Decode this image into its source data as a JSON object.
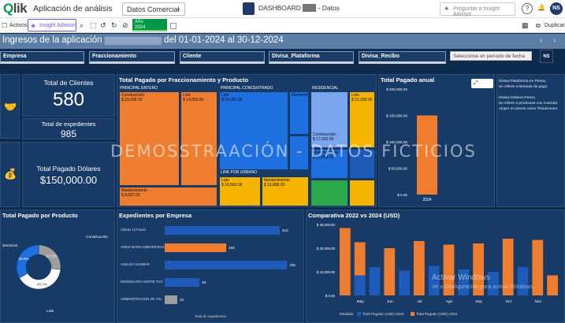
{
  "topbar": {
    "logo": "lik",
    "app_name": "Aplicación de análisis",
    "sheet_selector": "Datos Comercial",
    "dashboard_title": "DASHBOARD ",
    "dashboard_title_suffix": "- Datos",
    "search_placeholder": "Preguntar a Insight Advisor",
    "avatar": "NS"
  },
  "toolbar2": {
    "activos": "Activos",
    "insight": "Insight Advisor",
    "selection_field": "Año",
    "selection_value": "2024",
    "duplicar": "Duplicar"
  },
  "header": {
    "title_prefix": "Ingresos de la aplicación",
    "title_suffix": "del 01-01-2024 al 30-12-2024"
  },
  "filters": {
    "items": [
      "Empresa",
      "Fraccionamiento",
      "Cliente",
      "Divisa_Plataforma",
      "Divisa_Recibo"
    ],
    "date_placeholder": "Selecciona un periodo de fecha",
    "badge": "NS"
  },
  "kpis": {
    "clientes_label": "Total de Clientes",
    "clientes_value": "580",
    "expedientes_label": "Total de expedientes",
    "expedientes_value": "985",
    "pagado_label": "Total Pagado Dólares",
    "pagado_value": "$150,000.00"
  },
  "treemap": {
    "title": "Total Pagado por Fraccionamiento y Producto",
    "cells": [
      {
        "label": "PRINCIPAL ENTERO",
        "sub": "Construcción",
        "val": "$ 23,558.20",
        "color": "#ee7d30"
      },
      {
        "label": "",
        "sub": "Lote",
        "val": "$ 14,550.00",
        "color": "#ee7d30"
      },
      {
        "label": "",
        "sub": "Mantenimiento",
        "val": "$ 8,697.00",
        "color": "#ee7d30"
      },
      {
        "label": "PRINCIPAL CONCENTRADO",
        "sub": "Lote",
        "val": "$ 24,087.00",
        "color": "#1e6fe0"
      },
      {
        "label": "",
        "sub": "Mantenimiento",
        "val": "",
        "color": "#1e6fe0"
      },
      {
        "label": "",
        "sub": "Construcción",
        "val": "",
        "color": "#f5b400"
      },
      {
        "label": "RESIDENCIAL",
        "sub": "Construcción",
        "val": "$ 17,632.50",
        "color": "#7aa6f0"
      },
      {
        "label": "",
        "sub": "Mantenimiento",
        "val": "$ 22,858.00",
        "color": "#1e6fe0"
      },
      {
        "label": "",
        "sub": "Lote",
        "val": "$ 21,030.00",
        "color": "#f5b400"
      },
      {
        "label": "",
        "sub": "",
        "val": "",
        "color": "#2aa84a"
      },
      {
        "label": "",
        "sub": "Lote",
        "val": "$ 16,560.00",
        "color": "#f5b400"
      },
      {
        "label": "",
        "sub": "Mantenimiento",
        "val": "$ 15,888.20",
        "color": "#f5b400"
      },
      {
        "label": "",
        "sub": "",
        "val": "",
        "color": "#ee7d30"
      }
    ]
  },
  "anual": {
    "title": "Total Pagado anual",
    "yticks": [
      "$ 200,000.00",
      "$ 150,000.00",
      "$ 100,000.00",
      "$ 50,000.00",
      "$ 0.00"
    ],
    "category": "2024",
    "value": 150000
  },
  "notes": {
    "lines": [
      "Divisa Plataforma en Pesos,",
      "se refiere a Moneda de pago.",
      "",
      "Divisa Dólares Pesos,",
      "se refiere a productos con moneda",
      "origen en pesos como Titulaciones."
    ]
  },
  "pie": {
    "title": "Total Pagado por Producto",
    "labels": [
      "Construcción",
      "Servicios",
      "Lote"
    ],
    "values": [
      27.3,
      40.7,
      33.9
    ],
    "pct_labels": [
      "27.3%",
      "40.7%",
      "33.9%"
    ],
    "colors": [
      "#9e9e9e",
      "#ffffff",
      "#1e6fe0"
    ]
  },
  "empresa": {
    "title": "Expedientes por Empresa",
    "rows": [
      {
        "name": "Cliente 13 Fondo",
        "value": 310,
        "color": "#1e5bb8"
      },
      {
        "name": "ARIES MARIA AMBARRIDAS",
        "value": 166,
        "color": "#ee7d30"
      },
      {
        "name": "ASELEIA SUMMAR",
        "value": 330,
        "color": "#1e5bb8"
      },
      {
        "name": "INMOBILIARIA NORTE TUX",
        "value": 94,
        "color": "#1e5bb8"
      },
      {
        "name": "ADMINISTRACION DE YOL",
        "value": 34,
        "color": "#9e9e9e"
      }
    ],
    "xlabel": "Total de expedientes"
  },
  "comparativa": {
    "title": "Comparativa 2022 vs 2024 (USD)",
    "yticks": [
      "$ 30,000.00",
      "$ 20,000.00",
      "$ 10,000.00",
      "$ 0.00"
    ],
    "months": [
      "May",
      "Jun",
      "Jul",
      "Ago",
      "Sep",
      "Oct",
      "Nov"
    ],
    "legend_label": "Medidas",
    "series_2023": "Total Pagado (USD) 2023",
    "series_2024": "Total Pagado (USD) 2024"
  },
  "watermark": "DEMOSSTRAACIÓN - DATOS FICTICIOS",
  "activation": {
    "line1": "Activar Windows",
    "line2": "Ve a Configuración para activar Windows."
  },
  "chart_data": [
    {
      "type": "bar",
      "title": "Total Pagado anual",
      "categories": [
        "2024"
      ],
      "values": [
        150000
      ],
      "ylim": [
        0,
        200000
      ]
    },
    {
      "type": "pie",
      "title": "Total Pagado por Producto",
      "categories": [
        "Construcción",
        "Servicios",
        "Lote"
      ],
      "values": [
        27.3,
        40.7,
        33.9
      ]
    },
    {
      "type": "bar",
      "title": "Expedientes por Empresa",
      "categories": [
        "Cliente 13 Fondo",
        "ARIES MARIA AMBARRIDAS",
        "ASELEIA SUMMAR",
        "INMOBILIARIA NORTE TUX",
        "ADMINISTRACION DE YOL"
      ],
      "values": [
        310,
        166,
        330,
        94,
        34
      ],
      "xlabel": "Total de expedientes"
    },
    {
      "type": "bar",
      "title": "Comparativa 2022 vs 2024 (USD)",
      "categories": [
        "Apr",
        "May",
        "May2",
        "Jun",
        "Jun2",
        "Jul",
        "Jul2",
        "Ago",
        "Ago2",
        "Sep",
        "Sep2",
        "Oct",
        "Oct2",
        "Nov",
        "Nov2"
      ],
      "series": [
        {
          "name": "Total Pagado (USD) 2023",
          "values": [
            0,
            8500,
            12000,
            0,
            10500,
            0,
            12500,
            0,
            11000,
            0,
            10000,
            0,
            12000,
            0,
            0
          ]
        },
        {
          "name": "Total Pagado (USD) 2024",
          "values": [
            28500,
            22500,
            0,
            20000,
            0,
            23000,
            0,
            21500,
            0,
            22000,
            0,
            24000,
            0,
            23500,
            8500
          ]
        }
      ],
      "ylim": [
        0,
        30000
      ]
    }
  ]
}
